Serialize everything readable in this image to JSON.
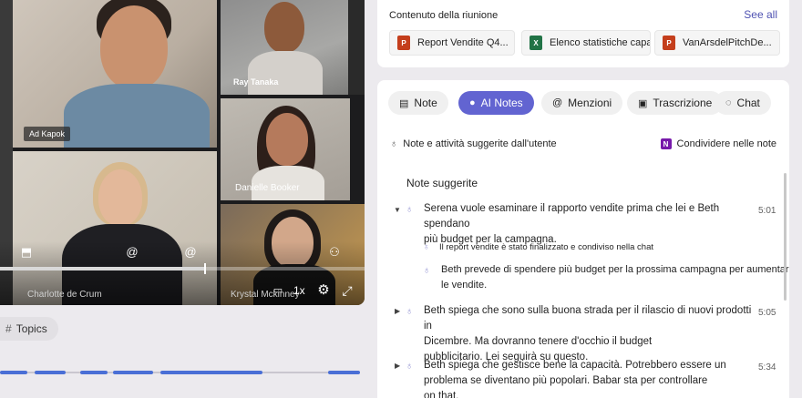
{
  "video": {
    "participants": [
      {
        "name": "Ad Kapok"
      },
      {
        "name": "Ray Tanaka"
      },
      {
        "name": "Danielle Booker"
      },
      {
        "name": "Charlotte de Crum"
      },
      {
        "name": "Krystal Mckinney"
      }
    ],
    "playback_speed": "1x",
    "progress": 0.56
  },
  "topics": {
    "label": "Topics"
  },
  "meeting_content": {
    "title": "Contenuto della riunione",
    "see_all": "See all",
    "files": [
      {
        "name": "Report Vendite Q4...",
        "icon": "powerpoint-icon",
        "color": "#c43e1c"
      },
      {
        "name": "Elenco statistiche capacità",
        "icon": "excel-icon",
        "color": "#217346"
      },
      {
        "name": "VanArsdelPitchDe...",
        "icon": "powerpoint-icon",
        "color": "#c43e1c"
      }
    ]
  },
  "tabs": [
    {
      "label": "Note",
      "icon": "note-icon"
    },
    {
      "label": "AI Notes",
      "icon": "lightbulb-icon",
      "active": true
    },
    {
      "label": "Menzioni",
      "icon": "at-icon"
    },
    {
      "label": "Trascrizione",
      "icon": "transcript-icon"
    },
    {
      "label": "Chat",
      "icon": "chat-icon"
    }
  ],
  "notes": {
    "suggested_label": "Note e attività suggerite dall'utente",
    "share_label": "Condividere nelle note",
    "heading": "Note suggerite",
    "items": [
      {
        "text_line1": "Serena vuole esaminare il rapporto vendite prima che lei e Beth spendano",
        "text_line2": "più budget per la campagna.",
        "time": "5:01",
        "expanded": true
      },
      {
        "text_line1": "Beth spiega che sono sulla buona strada per il rilascio di nuovi prodotti in",
        "text_line2": "Dicembre. Ma dovranno tenere d'occhio il budget",
        "text_line3": "pubblicitario. Lei seguirà su questo.",
        "time": "5:05"
      },
      {
        "text_line1": "Beth spiega che gestisce bene la capacità. Potrebbero essere un",
        "text_line2": "problema se diventano più popolari. Babar sta per controllare",
        "text_line3": "on that.",
        "time": "5:34"
      }
    ],
    "subitems": [
      {
        "text": "Il report vendite è stato finalizzato e condiviso nella chat"
      },
      {
        "text_line1": "Beth prevede di spendere più budget per la prossima campagna per aumentare",
        "text_line2": "le vendite."
      }
    ]
  }
}
